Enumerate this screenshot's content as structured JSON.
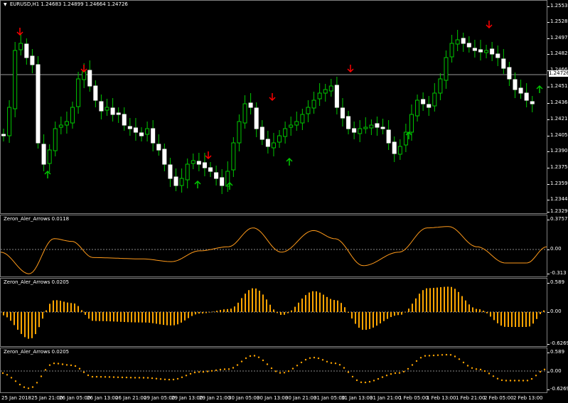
{
  "main_chart": {
    "title": "EURUSD,H1",
    "ohlc": "1.24683 1.24899 1.24664 1.24726",
    "current_price": "1.24726",
    "price_ticks": [
      "1.25530",
      "1.25280",
      "1.24970",
      "1.24820",
      "1.24665",
      "1.24510",
      "1.24360",
      "1.24210",
      "1.24055",
      "1.23900",
      "1.23750",
      "1.23595",
      "1.23445",
      "1.23290"
    ],
    "colors": {
      "bull": "#00c800",
      "bear": "#ffffff",
      "arrow_up": "#00c800",
      "arrow_down": "#ff0000",
      "price_line": "#9a9a9a"
    }
  },
  "indicator_1": {
    "title": "Zeron_Aler_Arrows 0.0118",
    "ticks": [
      "0.3757",
      "0.00",
      "-0.313"
    ],
    "color": "#ff9a1a"
  },
  "indicator_2": {
    "title": "Zeron_Aler_Arrows 0.0205",
    "ticks": [
      "0.589",
      "0.00",
      "-0.6269"
    ],
    "color": "#ffa500"
  },
  "indicator_3": {
    "title": "Zeron_Aler_Arrows 0.0205",
    "ticks": [
      "0.589",
      "0.00",
      "-0.6269"
    ],
    "color": "#ffa500"
  },
  "time_axis": [
    "25 Jan 2018",
    "25 Jan 21:00",
    "26 Jan 05:00",
    "26 Jan 13:00",
    "26 Jan 21:00",
    "29 Jan 05:00",
    "29 Jan 13:00",
    "29 Jan 21:00",
    "30 Jan 05:00",
    "30 Jan 13:00",
    "30 Jan 21:00",
    "31 Jan 05:00",
    "31 Jan 13:00",
    "31 Jan 21:00",
    "1 Feb 05:00",
    "1 Feb 13:00",
    "1 Feb 21:00",
    "2 Feb 05:00",
    "2 Feb 13:00"
  ],
  "menu_icon": "triangle-down-icon"
}
